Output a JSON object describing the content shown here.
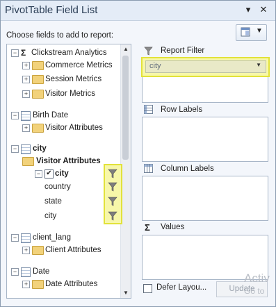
{
  "window": {
    "title": "PivotTable Field List",
    "close_glyph": "✕",
    "menu_glyph": "▾"
  },
  "choose_label": "Choose fields to add to report:",
  "tree": {
    "items": [
      {
        "label": "Clickstream Analytics",
        "kind": "sigma",
        "expander": "⊟"
      },
      {
        "label": "Commerce Metrics",
        "kind": "folder",
        "expander": "+"
      },
      {
        "label": "Session Metrics",
        "kind": "folder",
        "expander": "+"
      },
      {
        "label": "Visitor Metrics",
        "kind": "folder",
        "expander": "+"
      },
      {
        "label": "Birth Date",
        "kind": "table",
        "expander": "−"
      },
      {
        "label": "Visitor Attributes",
        "kind": "folder",
        "expander": "+"
      },
      {
        "label": "city",
        "kind": "table",
        "expander": "−"
      },
      {
        "label": "Visitor Attributes",
        "kind": "folder",
        "expander": "−"
      },
      {
        "label": "city",
        "kind": "check",
        "expander": "−",
        "checked": true
      },
      {
        "label": "country",
        "kind": "plain"
      },
      {
        "label": "state",
        "kind": "plain"
      },
      {
        "label": "city",
        "kind": "plain"
      },
      {
        "label": "client_lang",
        "kind": "table",
        "expander": "−"
      },
      {
        "label": "Client Attributes",
        "kind": "folder",
        "expander": "+"
      },
      {
        "label": "Date",
        "kind": "table",
        "expander": "−"
      },
      {
        "label": "Date Attributes",
        "kind": "folder",
        "expander": "+"
      }
    ]
  },
  "areas": {
    "report_filter": {
      "label": "Report Filter",
      "field": "city"
    },
    "row_labels": {
      "label": "Row Labels"
    },
    "column_labels": {
      "label": "Column Labels"
    },
    "values": {
      "label": "Values"
    }
  },
  "footer": {
    "defer_label": "Defer Layou...",
    "update_label": "Update"
  },
  "watermark": {
    "line1": "Activ",
    "line2": "Go to"
  },
  "colors": {
    "highlight": "#f7f7a9",
    "highlight_border": "#e2e23a",
    "title_bg": "#e4ecf7"
  }
}
